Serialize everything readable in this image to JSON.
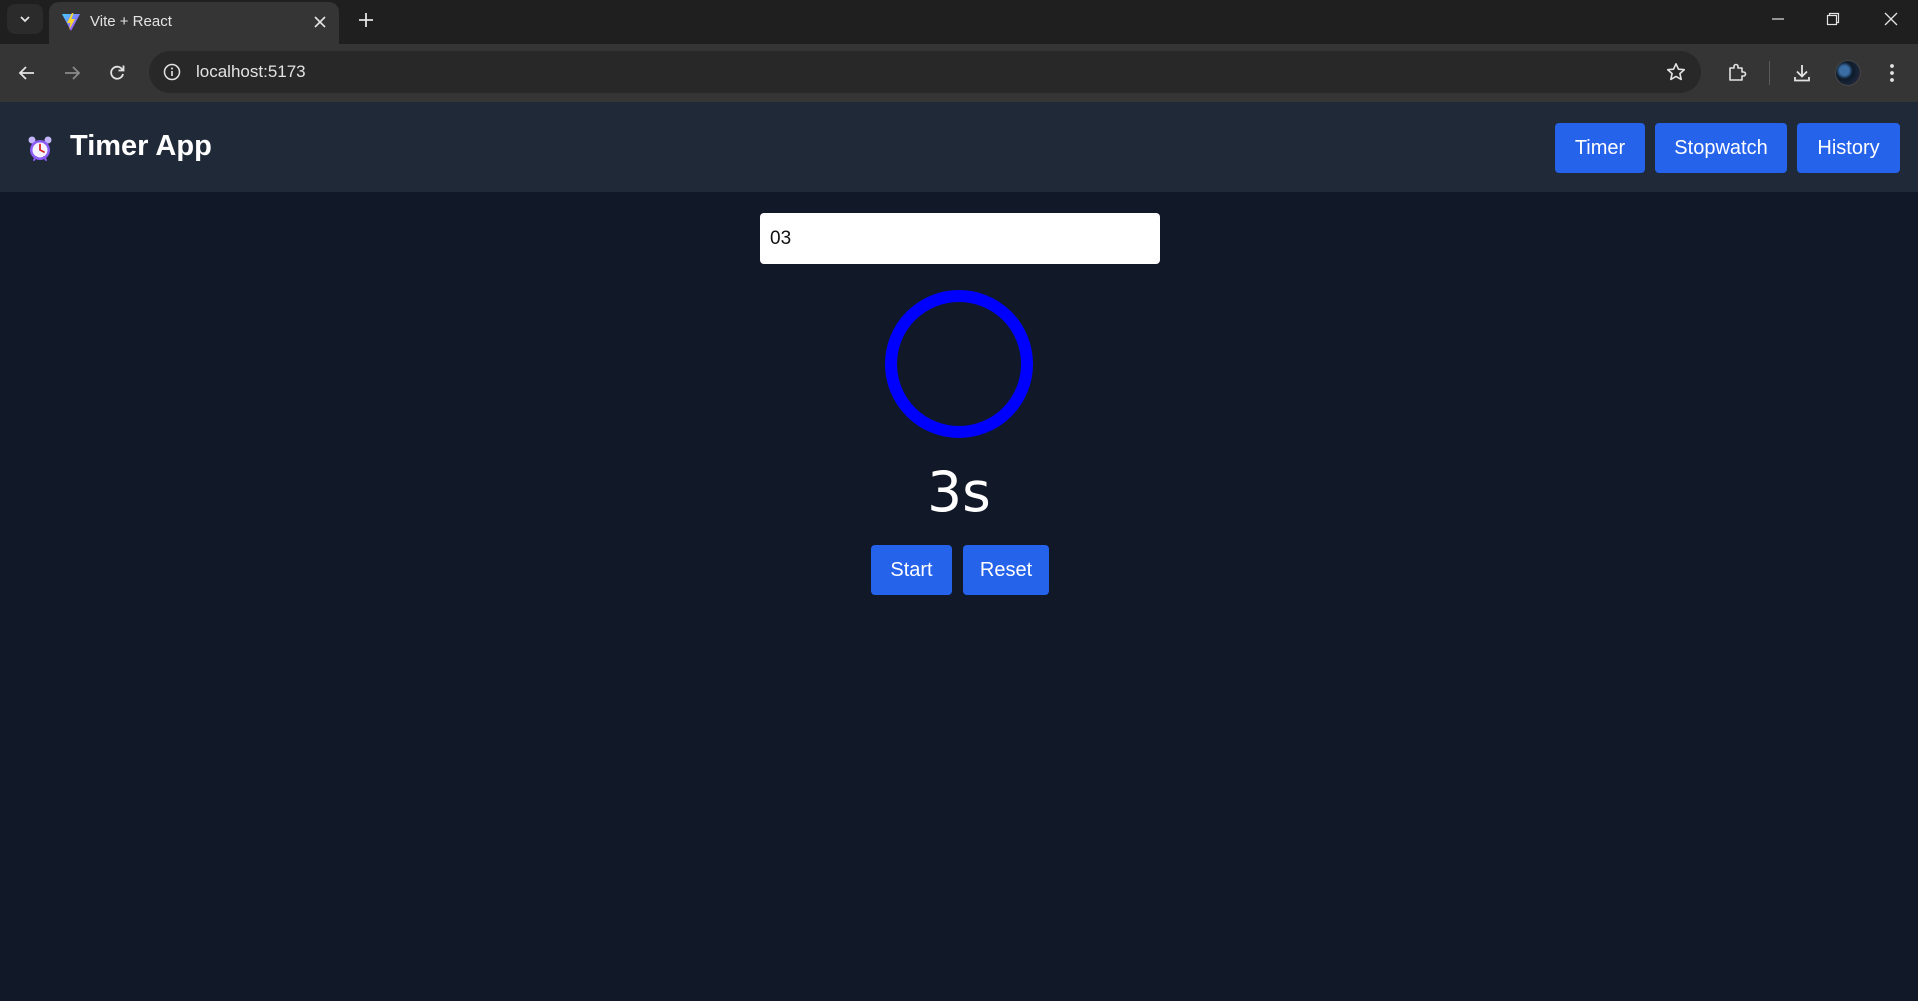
{
  "browser": {
    "tab": {
      "title": "Vite + React",
      "favicon": "vite-logo-icon"
    },
    "address_bar": {
      "url": "localhost:5173"
    }
  },
  "app": {
    "title": "Timer App",
    "logo_icon": "alarm-clock-icon",
    "nav": [
      {
        "label": "Timer"
      },
      {
        "label": "Stopwatch"
      },
      {
        "label": "History"
      }
    ],
    "accent_color": "#2563eb"
  },
  "timer": {
    "input_value": "03",
    "ring_color": "#0000ff",
    "display": "3s",
    "start_label": "Start",
    "reset_label": "Reset"
  }
}
